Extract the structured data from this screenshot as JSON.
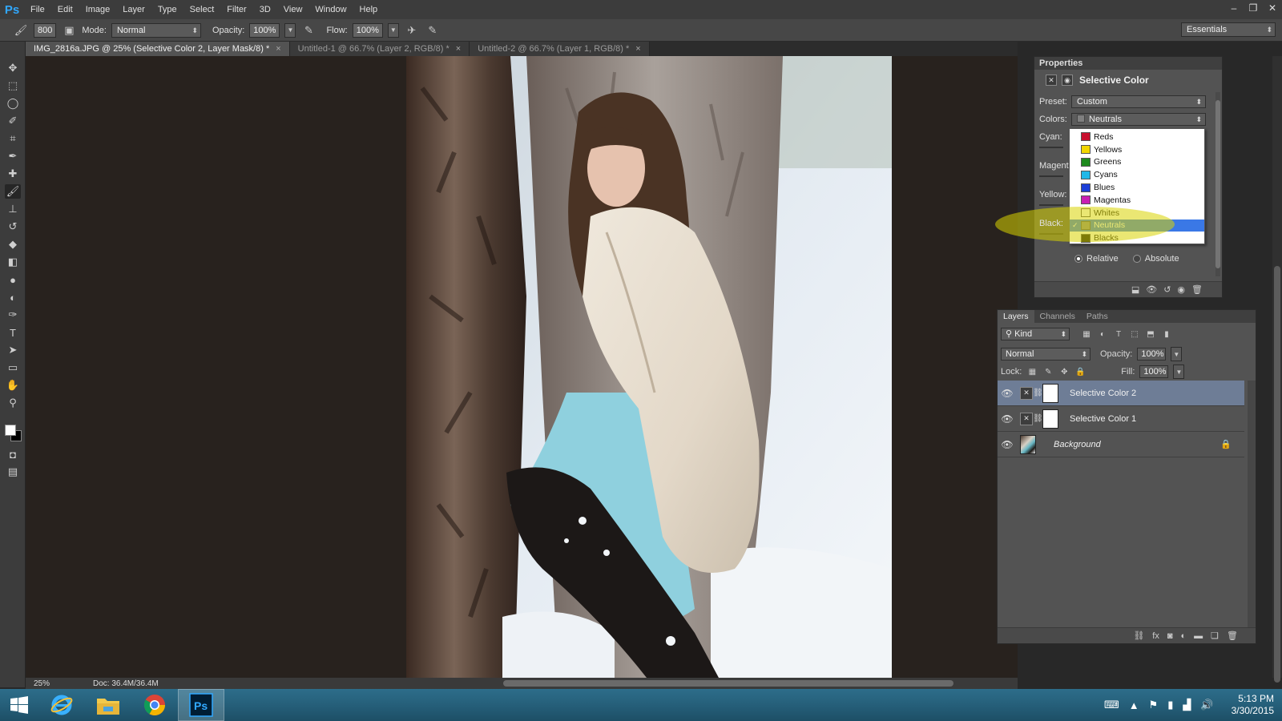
{
  "app": {
    "logo": "Ps",
    "menu": [
      "File",
      "Edit",
      "Image",
      "Layer",
      "Type",
      "Select",
      "Filter",
      "3D",
      "View",
      "Window",
      "Help"
    ],
    "window_controls": {
      "minimize": "–",
      "restore": "❐",
      "close": "✕"
    }
  },
  "options_bar": {
    "brush_size": "800",
    "mode_label": "Mode:",
    "mode_value": "Normal",
    "opacity_label": "Opacity:",
    "opacity_value": "100%",
    "flow_label": "Flow:",
    "flow_value": "100%",
    "workspace": "Essentials"
  },
  "tabs": [
    {
      "label": "IMG_2816a.JPG @ 25% (Selective Color 2, Layer Mask/8) *",
      "active": true
    },
    {
      "label": "Untitled-1 @ 66.7% (Layer 2, RGB/8) *",
      "active": false
    },
    {
      "label": "Untitled-2 @ 66.7% (Layer 1, RGB/8) *",
      "active": false
    }
  ],
  "tab_close_glyph": "×",
  "tools": [
    "move-tool",
    "marquee-tool",
    "lasso-tool",
    "quick-select-tool",
    "crop-tool",
    "eyedropper-tool",
    "healing-brush-tool",
    "brush-tool",
    "clone-stamp-tool",
    "history-brush-tool",
    "eraser-tool",
    "paint-bucket-tool",
    "blur-tool",
    "dodge-tool",
    "pen-tool",
    "type-tool",
    "path-select-tool",
    "rectangle-tool",
    "hand-tool",
    "zoom-tool"
  ],
  "colors": {
    "foreground": "#ffffff",
    "background": "#000000",
    "accent": "#3a78e6",
    "highlight": "#d8d400"
  },
  "status": {
    "zoom": "25%",
    "doc_size": "Doc: 36.4M/36.4M"
  },
  "properties": {
    "panel_title": "Properties",
    "adjustment_title": "Selective Color",
    "preset_label": "Preset:",
    "preset_value": "Custom",
    "colors_label": "Colors:",
    "colors_value": "Neutrals",
    "slider_labels": {
      "cyan": "Cyan:",
      "magenta": "Magent",
      "yellow": "Yellow:",
      "black": "Black:"
    },
    "method_options": [
      {
        "label": "Relative",
        "checked": true
      },
      {
        "label": "Absolute",
        "checked": false
      }
    ],
    "dropdown_items": [
      {
        "label": "Reds",
        "swatch": "#c8102e",
        "selected": false
      },
      {
        "label": "Yellows",
        "swatch": "#f2d600",
        "selected": false
      },
      {
        "label": "Greens",
        "swatch": "#1e8a1e",
        "selected": false
      },
      {
        "label": "Cyans",
        "swatch": "#22b8e8",
        "selected": false
      },
      {
        "label": "Blues",
        "swatch": "#1c3fd8",
        "selected": false
      },
      {
        "label": "Magentas",
        "swatch": "#c81eb4",
        "selected": false
      },
      {
        "label": "Whites",
        "swatch": "#ffffff",
        "selected": false
      },
      {
        "label": "Neutrals",
        "swatch": "#8a8a8a",
        "selected": true
      },
      {
        "label": "Blacks",
        "swatch": "#111111",
        "selected": false
      }
    ]
  },
  "layers": {
    "tabs": [
      {
        "label": "Layers",
        "active": true
      },
      {
        "label": "Channels",
        "active": false
      },
      {
        "label": "Paths",
        "active": false
      }
    ],
    "filter_kind": "Kind",
    "blend_mode": "Normal",
    "opacity_label": "Opacity:",
    "opacity_value": "100%",
    "lock_label": "Lock:",
    "fill_label": "Fill:",
    "fill_value": "100%",
    "items": [
      {
        "name": "Selective Color 2",
        "selected": true,
        "type": "adjustment"
      },
      {
        "name": "Selective Color 1",
        "selected": false,
        "type": "adjustment"
      },
      {
        "name": "Background",
        "selected": false,
        "type": "image",
        "locked": true
      }
    ]
  },
  "taskbar": {
    "time": "5:13 PM",
    "date": "3/30/2015"
  }
}
